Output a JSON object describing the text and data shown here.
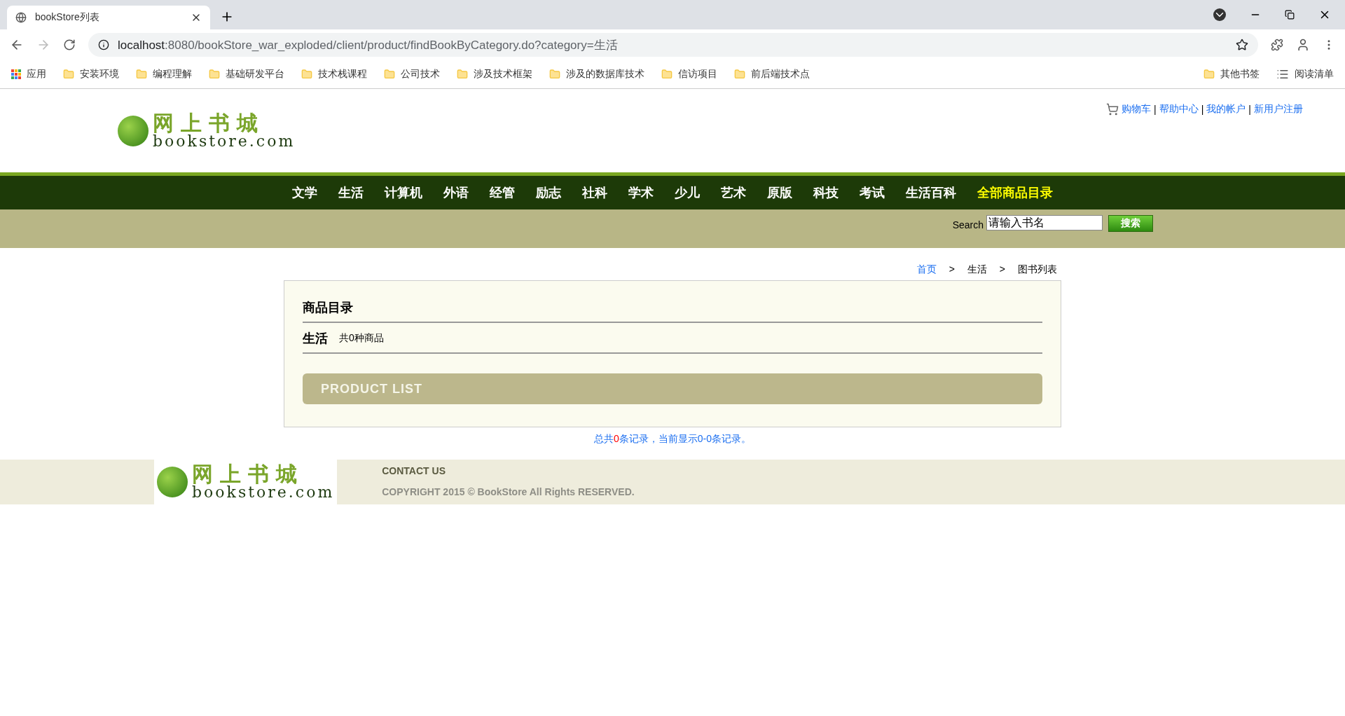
{
  "browser": {
    "tab_title": "bookStore列表",
    "url_host": "localhost",
    "url_rest": ":8080/bookStore_war_exploded/client/product/findBookByCategory.do?category=生活",
    "bookmarks": [
      {
        "label": "应用",
        "kind": "apps"
      },
      {
        "label": "安装环境",
        "kind": "folder"
      },
      {
        "label": "编程理解",
        "kind": "folder"
      },
      {
        "label": "基础研发平台",
        "kind": "folder"
      },
      {
        "label": "技术栈课程",
        "kind": "folder"
      },
      {
        "label": "公司技术",
        "kind": "folder"
      },
      {
        "label": "涉及技术框架",
        "kind": "folder"
      },
      {
        "label": "涉及的数据库技术",
        "kind": "folder"
      },
      {
        "label": "信访项目",
        "kind": "folder"
      },
      {
        "label": "前后端技术点",
        "kind": "folder"
      }
    ],
    "bookmarks_right": [
      {
        "label": "其他书签",
        "kind": "folder"
      },
      {
        "label": "阅读清单",
        "kind": "list"
      }
    ]
  },
  "header": {
    "logo_title": "网上书城",
    "logo_subtitle": "bookstore.com",
    "links": [
      "购物车",
      "帮助中心",
      "我的帐户",
      "新用户注册"
    ],
    "link_separators": [
      "|",
      "|",
      "|"
    ]
  },
  "nav": [
    {
      "label": "文学",
      "selected": false
    },
    {
      "label": "生活",
      "selected": false
    },
    {
      "label": "计算机",
      "selected": false
    },
    {
      "label": "外语",
      "selected": false
    },
    {
      "label": "经管",
      "selected": false
    },
    {
      "label": "励志",
      "selected": false
    },
    {
      "label": "社科",
      "selected": false
    },
    {
      "label": "学术",
      "selected": false
    },
    {
      "label": "少儿",
      "selected": false
    },
    {
      "label": "艺术",
      "selected": false
    },
    {
      "label": "原版",
      "selected": false
    },
    {
      "label": "科技",
      "selected": false
    },
    {
      "label": "考试",
      "selected": false
    },
    {
      "label": "生活百科",
      "selected": false
    },
    {
      "label": "全部商品目录",
      "selected": true
    }
  ],
  "search": {
    "label": "Search",
    "value": "请输入书名",
    "button": "搜索"
  },
  "breadcrumb": [
    {
      "label": "首页",
      "link": true
    },
    {
      "label": "生活",
      "link": false
    },
    {
      "label": "图书列表",
      "link": false
    }
  ],
  "breadcrumb_separators": [
    ">",
    ">"
  ],
  "catalog": {
    "title": "商品目录",
    "category": "生活",
    "count_text": "共0种商品",
    "banner": "PRODUCT LIST"
  },
  "summary": {
    "prefix": "总共",
    "count": "0",
    "suffix": "条记录，当前显示0-0条记录。"
  },
  "footer": {
    "logo_title": "网上书城",
    "logo_subtitle": "bookstore.com",
    "contact": "CONTACT US",
    "copyright": "COPYRIGHT 2015 © BookStore All Rights RESERVED."
  }
}
